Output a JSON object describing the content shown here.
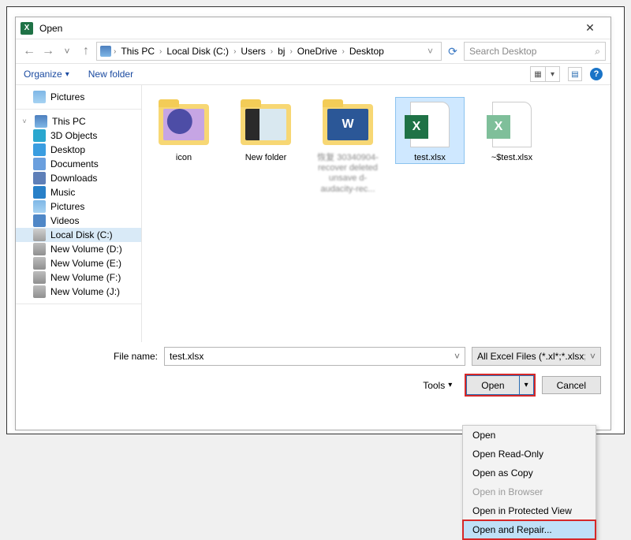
{
  "window": {
    "title": "Open"
  },
  "breadcrumbs": {
    "items": [
      "This PC",
      "Local Disk (C:)",
      "Users",
      "bj",
      "OneDrive",
      "Desktop"
    ]
  },
  "search": {
    "placeholder": "Search Desktop"
  },
  "toolbar": {
    "organize": "Organize",
    "new_folder": "New folder"
  },
  "sidebar": {
    "top": [
      {
        "label": "Pictures"
      }
    ],
    "thispc_label": "This PC",
    "items": [
      {
        "label": "3D Objects"
      },
      {
        "label": "Desktop"
      },
      {
        "label": "Documents"
      },
      {
        "label": "Downloads"
      },
      {
        "label": "Music"
      },
      {
        "label": "Pictures"
      },
      {
        "label": "Videos"
      },
      {
        "label": "Local Disk (C:)",
        "selected": true
      },
      {
        "label": "New Volume (D:)"
      },
      {
        "label": "New Volume (E:)"
      },
      {
        "label": "New Volume (F:)"
      },
      {
        "label": "New Volume (J:)"
      }
    ]
  },
  "files": {
    "items": [
      {
        "name": "icon",
        "kind": "folder",
        "overlay": "icon"
      },
      {
        "name": "New folder",
        "kind": "folder",
        "overlay": "photo"
      },
      {
        "name_blurred": "恢复 30340904-recover deleted unsave d-audacity-rec...",
        "kind": "folder",
        "overlay": "word"
      },
      {
        "name": "test.xlsx",
        "kind": "excel",
        "selected": true
      },
      {
        "name": "~$test.xlsx",
        "kind": "excel",
        "dim": true
      }
    ]
  },
  "filename": {
    "label": "File name:",
    "value": "test.xlsx"
  },
  "filter": {
    "text": "All Excel Files (*.xl*;*.xlsx;*.xlsm"
  },
  "tools_label": "Tools",
  "buttons": {
    "open": "Open",
    "cancel": "Cancel"
  },
  "open_menu": {
    "items": [
      {
        "label": "Open"
      },
      {
        "label": "Open Read-Only"
      },
      {
        "label": "Open as Copy"
      },
      {
        "label": "Open in Browser",
        "disabled": true
      },
      {
        "label": "Open in Protected View"
      },
      {
        "label": "Open and Repair...",
        "hover": true
      }
    ]
  }
}
